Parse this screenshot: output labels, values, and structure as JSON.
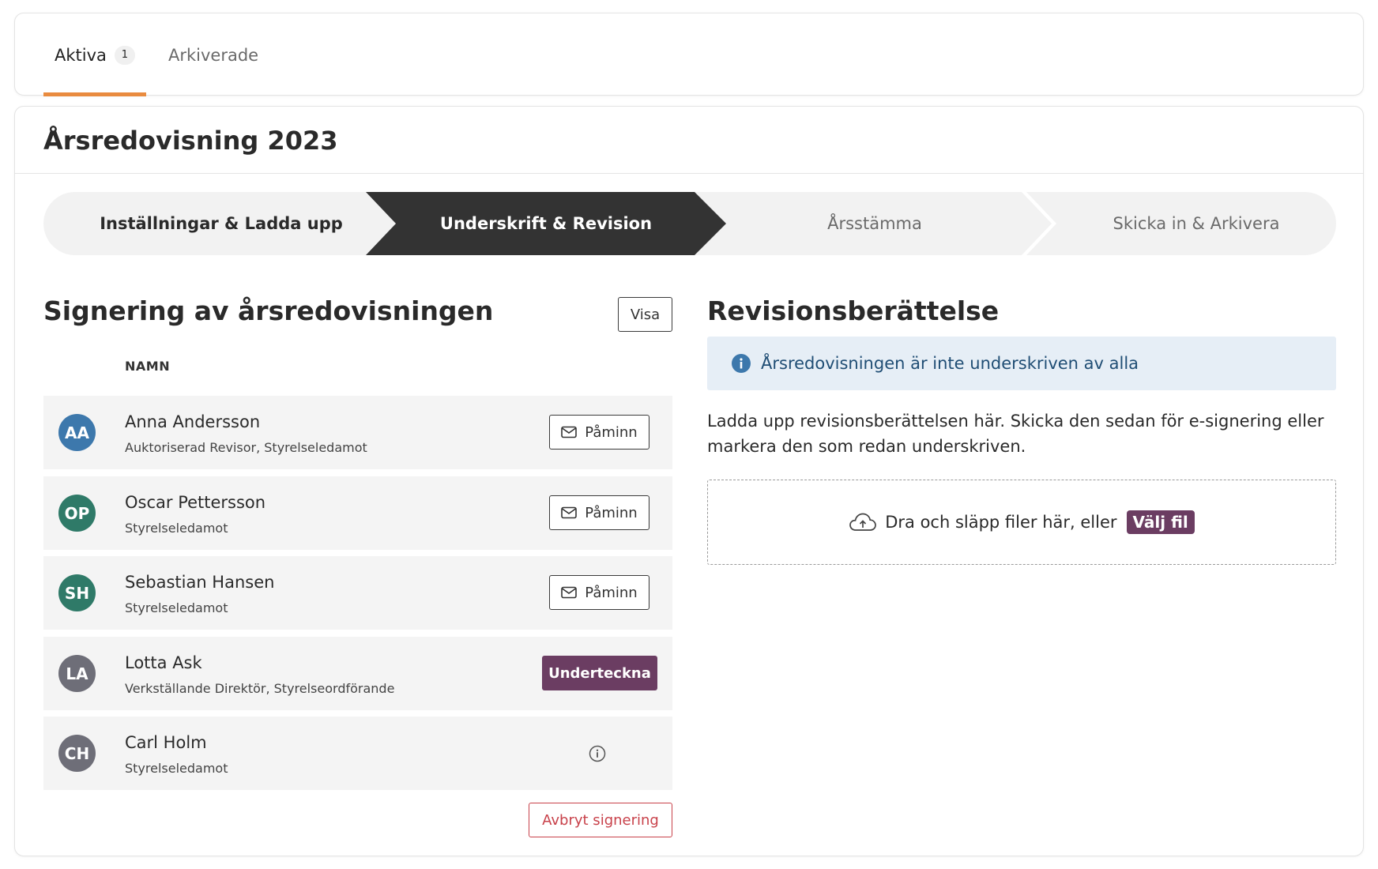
{
  "tabs": {
    "active_label": "Aktiva",
    "active_count": "1",
    "archived_label": "Arkiverade"
  },
  "page": {
    "title": "Årsredovisning 2023"
  },
  "stepper": {
    "steps": [
      {
        "label": "Inställningar & Ladda upp",
        "state": "completed"
      },
      {
        "label": "Underskrift & Revision",
        "state": "current"
      },
      {
        "label": "Årsstämma",
        "state": "upcoming"
      },
      {
        "label": "Skicka in & Arkivera",
        "state": "upcoming"
      }
    ]
  },
  "signing": {
    "title": "Signering av årsredovisningen",
    "view_button": "Visa",
    "column_name": "NAMN",
    "remind_label": "Påminn",
    "sign_label": "Underteckna",
    "cancel_button": "Avbryt signering",
    "signers": [
      {
        "initials": "AA",
        "name": "Anna Andersson",
        "role": "Auktoriserad Revisor, Styrelseledamot",
        "avatar_color": "#3d78ac",
        "action": "remind"
      },
      {
        "initials": "OP",
        "name": "Oscar Pettersson",
        "role": "Styrelseledamot",
        "avatar_color": "#2f7a68",
        "action": "remind"
      },
      {
        "initials": "SH",
        "name": "Sebastian Hansen",
        "role": "Styrelseledamot",
        "avatar_color": "#2f7a68",
        "action": "remind"
      },
      {
        "initials": "LA",
        "name": "Lotta Ask",
        "role": "Verkställande Direktör, Styrelseordförande",
        "avatar_color": "#6e6e78",
        "action": "sign"
      },
      {
        "initials": "CH",
        "name": "Carl Holm",
        "role": "Styrelseledamot",
        "avatar_color": "#6e6e78",
        "action": "info"
      }
    ]
  },
  "revision": {
    "title": "Revisionsberättelse",
    "alert_text": "Årsredovisningen är inte underskriven av alla",
    "description": "Ladda upp revisionsberättelsen här. Skicka den sedan för e-signering eller markera den som redan underskriven.",
    "drop_text": "Dra och släpp filer här, eller",
    "choose_file": "Välj fil"
  },
  "colors": {
    "accent_orange": "#e98b3f",
    "brand_purple": "#6b3d62",
    "step_dark": "#333333",
    "step_light": "#f2f2f2",
    "danger": "#c8414a",
    "info_bg": "#e6eef6",
    "info_icon": "#3d78ac"
  },
  "icons": {
    "remind": "envelope-icon",
    "info": "info-circle-icon",
    "alert": "info-filled-icon",
    "upload": "cloud-upload-icon"
  }
}
